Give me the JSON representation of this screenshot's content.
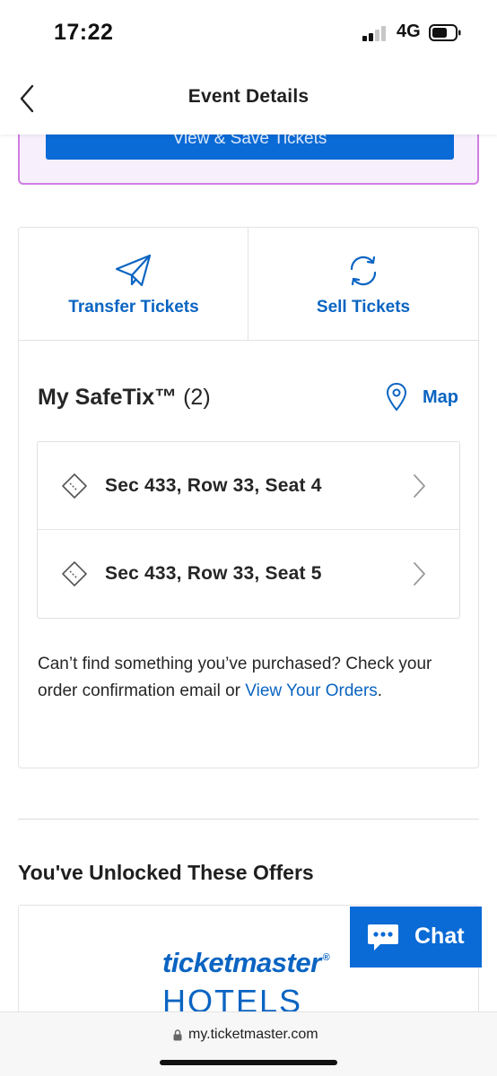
{
  "status_bar": {
    "time": "17:22",
    "network": "4G",
    "icons": [
      "signal-icon",
      "battery-icon"
    ]
  },
  "header": {
    "title": "Event Details",
    "back_icon": "chevron-left-icon"
  },
  "purple_box": {
    "button_label": "View & Save Tickets"
  },
  "actions": {
    "transfer": {
      "label": "Transfer Tickets",
      "icon": "paper-plane-icon"
    },
    "sell": {
      "label": "Sell Tickets",
      "icon": "refresh-icon"
    }
  },
  "safetix": {
    "title": "My SafeTix™",
    "count": "(2)",
    "map_label": "Map",
    "map_icon": "map-pin-icon",
    "seats": [
      {
        "label": "Sec 433, Row 33, Seat 4",
        "icon": "ticket-icon"
      },
      {
        "label": "Sec 433, Row 33, Seat 5",
        "icon": "ticket-icon"
      }
    ],
    "help_text_before": "Can’t find something you’ve purchased? Check your order confirmation email or ",
    "help_link": "View Your Orders",
    "help_text_after": "."
  },
  "offers": {
    "title": "You've Unlocked These Offers",
    "card": {
      "logo_text": "ticketmaster",
      "logo_mark": "®",
      "logo_subtext": "HOTELS"
    }
  },
  "chat": {
    "label": "Chat",
    "icon": "chat-bubble-icon"
  },
  "url_bar": {
    "url": "my.ticketmaster.com",
    "icon": "lock-icon"
  },
  "colors": {
    "brand_blue": "#0a64c2",
    "button_blue": "#0a6ad6",
    "purple_border": "#d17ce3"
  }
}
